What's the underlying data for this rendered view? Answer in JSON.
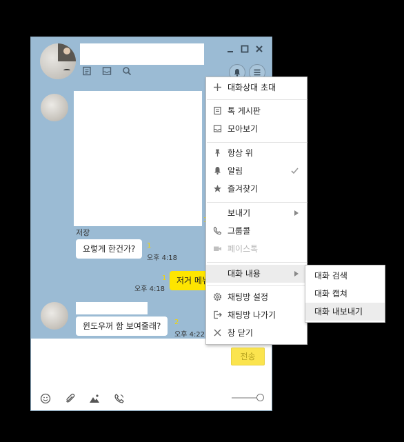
{
  "chat": {
    "image_caption": "저장",
    "messages": [
      {
        "text": "요렇게 한건가?",
        "unread": "1",
        "time": "오후 4:18"
      },
      {
        "text": "저거 메뉴",
        "unread": "1",
        "time": "오후 4:18"
      },
      {
        "text": "윈도우꺼 함 보여줄래?",
        "unread": "2",
        "time": "오후 4:22"
      }
    ]
  },
  "input": {
    "send_label": "전송"
  },
  "menu": {
    "items": [
      {
        "label": "대화상대 초대",
        "icon": "plus-icon"
      },
      {
        "label": "톡 게시판",
        "icon": "board-icon"
      },
      {
        "label": "모아보기",
        "icon": "inbox-icon"
      },
      {
        "label": "항상 위",
        "icon": "pin-icon"
      },
      {
        "label": "알림",
        "icon": "bell-icon",
        "checked": true
      },
      {
        "label": "즐겨찾기",
        "icon": "star-icon"
      },
      {
        "label": "보내기",
        "icon": "none",
        "submenu": true
      },
      {
        "label": "그룹콜",
        "icon": "phone-icon"
      },
      {
        "label": "페이스톡",
        "icon": "video-icon",
        "disabled": true
      },
      {
        "label": "대화 내용",
        "icon": "none",
        "submenu": true,
        "highlighted": true
      },
      {
        "label": "채팅방 설정",
        "icon": "gear-icon"
      },
      {
        "label": "채팅방 나가기",
        "icon": "exit-icon"
      },
      {
        "label": "창 닫기",
        "icon": "close-icon"
      }
    ]
  },
  "submenu": {
    "items": [
      {
        "label": "대화 검색"
      },
      {
        "label": "대화 캡쳐"
      },
      {
        "label": "대화 내보내기",
        "highlighted": true
      }
    ]
  },
  "colors": {
    "chat_bg": "#9bbbd4",
    "my_bubble": "#fee500",
    "send_button": "#fbe44e",
    "unread_count": "#f5d400"
  }
}
